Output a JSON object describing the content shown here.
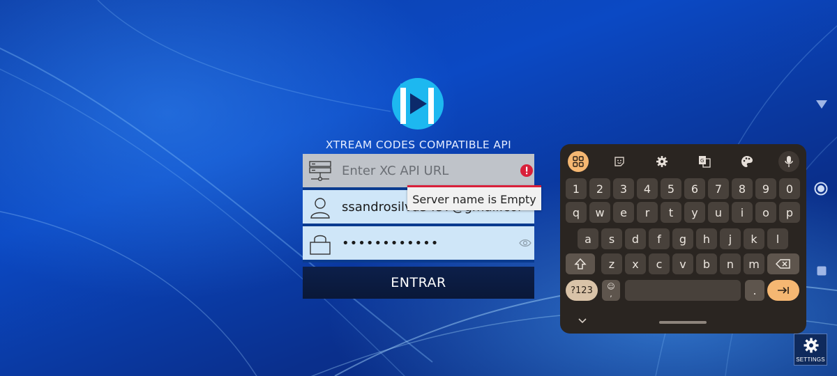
{
  "app": {
    "title": "XTREAM CODES COMPATIBLE API"
  },
  "form": {
    "url_placeholder": "Enter XC API URL",
    "url_value": "",
    "username_value": "ssandrosilva5457@gmail.com",
    "password_value": "••••••••••••",
    "error_tooltip": "Server name is Empty",
    "login_label": "ENTRAR"
  },
  "keyboard": {
    "number_row": [
      "1",
      "2",
      "3",
      "4",
      "5",
      "6",
      "7",
      "8",
      "9",
      "0"
    ],
    "row1": [
      "q",
      "w",
      "e",
      "r",
      "t",
      "y",
      "u",
      "i",
      "o",
      "p"
    ],
    "row2": [
      "a",
      "s",
      "d",
      "f",
      "g",
      "h",
      "j",
      "k",
      "l"
    ],
    "row3": [
      "z",
      "x",
      "c",
      "v",
      "b",
      "n",
      "m"
    ],
    "symbols_label": "?123",
    "period_label": ".",
    "emoji_sub_label": ",",
    "toolbar_icons": [
      "apps-grid-icon",
      "sticker-icon",
      "settings-icon",
      "translate-icon",
      "palette-icon",
      "mic-icon"
    ]
  },
  "settings": {
    "label": "SETTINGS"
  },
  "colors": {
    "accent": "#f5b772",
    "error": "#d9203a",
    "logo": "#1db8f0"
  }
}
